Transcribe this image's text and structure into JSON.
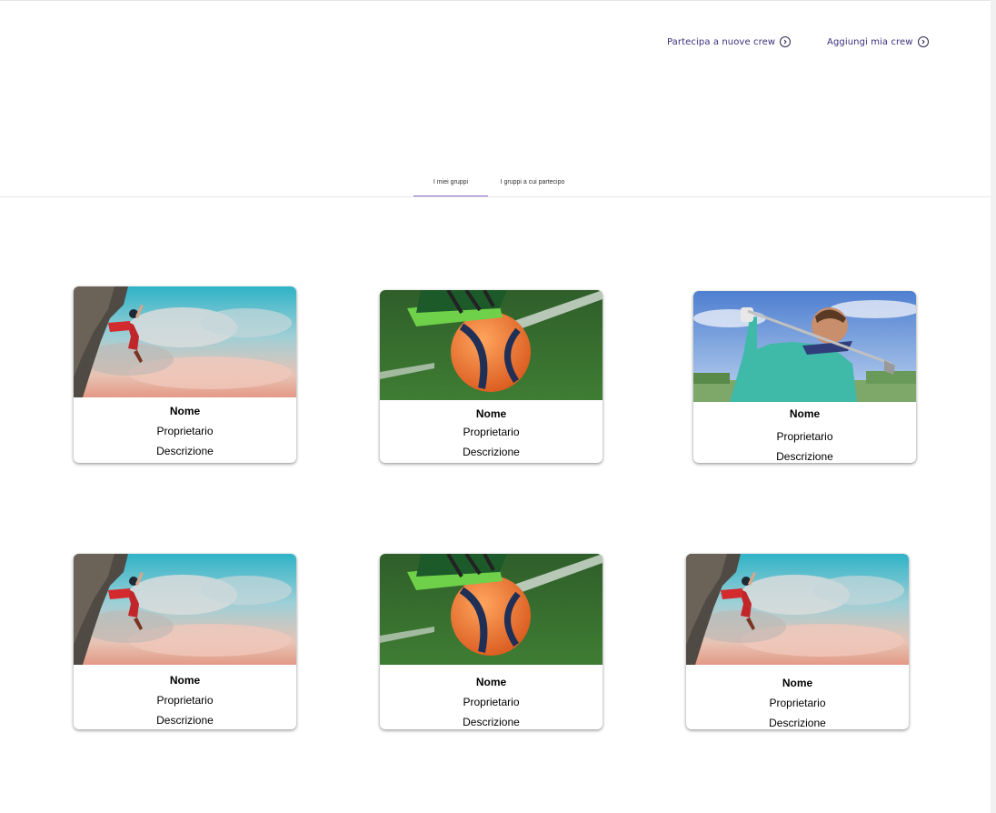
{
  "header": {
    "join_link": "Partecipa a nuove crew",
    "add_link": "Aggiungi mia crew"
  },
  "tabs": [
    {
      "label": "I miei gruppi",
      "active": true
    },
    {
      "label": "I gruppi a cui partecipo",
      "active": false
    }
  ],
  "cards": [
    {
      "image": "climber",
      "name": "Nome",
      "owner": "Proprietario",
      "description": "Descrizione"
    },
    {
      "image": "soccer-ball",
      "name": "Nome",
      "owner": "Proprietario",
      "description": "Descrizione"
    },
    {
      "image": "golfer",
      "name": "Nome",
      "owner": "Proprietario",
      "description": "Descrizione"
    },
    {
      "image": "climber",
      "name": "Nome",
      "owner": "Proprietario",
      "description": "Descrizione"
    },
    {
      "image": "soccer-ball",
      "name": "Nome",
      "owner": "Proprietario",
      "description": "Descrizione"
    },
    {
      "image": "climber",
      "name": "Nome",
      "owner": "Proprietario",
      "description": "Descrizione"
    }
  ],
  "colors": {
    "accent": "#8b6bd0",
    "link": "#3b2f7a"
  }
}
